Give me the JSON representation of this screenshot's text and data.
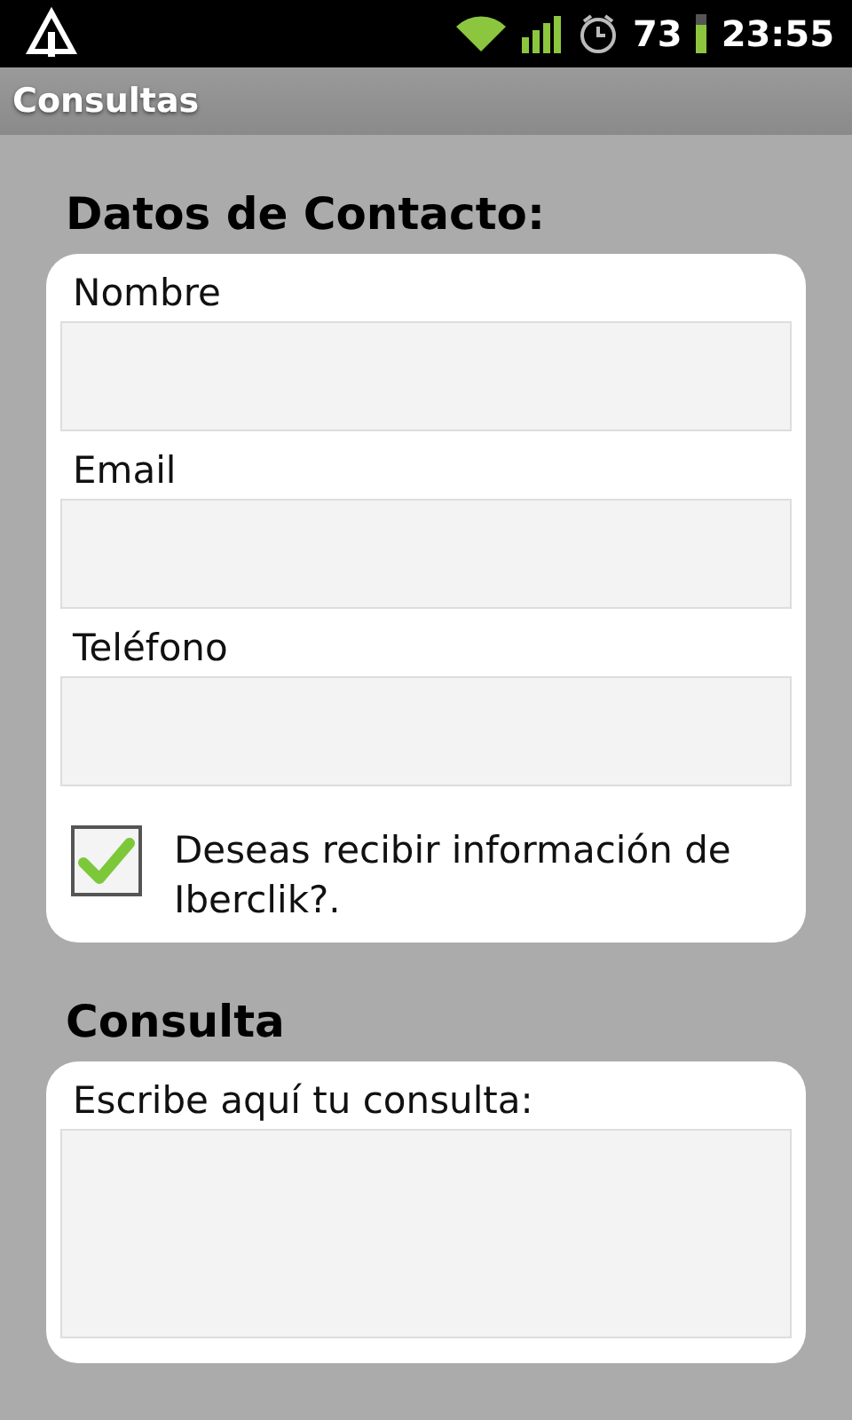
{
  "status_bar": {
    "battery": "73",
    "time": "23:55"
  },
  "title_bar": {
    "title": "Consultas"
  },
  "sections": [
    {
      "heading": "Datos de Contacto:",
      "fields": [
        {
          "label": "Nombre",
          "kind": "text"
        },
        {
          "label": "Email",
          "kind": "text"
        },
        {
          "label": "Teléfono",
          "kind": "text"
        }
      ],
      "checkbox": {
        "label": "Deseas recibir información de Iberclik?.",
        "checked": true
      }
    },
    {
      "heading": "Consulta",
      "fields": [
        {
          "label": "Escribe aquí tu consulta:",
          "kind": "textarea"
        }
      ]
    }
  ]
}
